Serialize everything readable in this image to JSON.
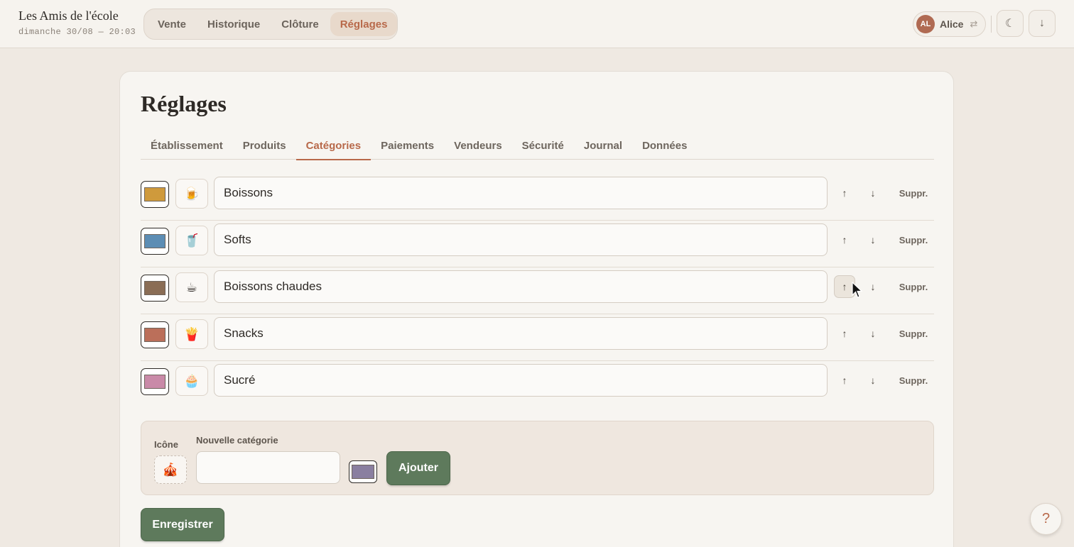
{
  "app": {
    "title": "Les Amis de l'école",
    "datetime": "dimanche 30/08 — 20:03"
  },
  "nav": [
    {
      "label": "Vente",
      "active": false
    },
    {
      "label": "Historique",
      "active": false
    },
    {
      "label": "Clôture",
      "active": false
    },
    {
      "label": "Réglages",
      "active": true
    }
  ],
  "user": {
    "initials": "AL",
    "name": "Alice",
    "switch_icon": "⇄"
  },
  "toolbar": {
    "theme_icon": "☾",
    "download_icon": "↓"
  },
  "page": {
    "title": "Réglages"
  },
  "tabs": [
    {
      "label": "Établissement",
      "active": false
    },
    {
      "label": "Produits",
      "active": false
    },
    {
      "label": "Catégories",
      "active": true
    },
    {
      "label": "Paiements",
      "active": false
    },
    {
      "label": "Vendeurs",
      "active": false
    },
    {
      "label": "Sécurité",
      "active": false
    },
    {
      "label": "Journal",
      "active": false
    },
    {
      "label": "Données",
      "active": false
    }
  ],
  "categories": [
    {
      "name": "Boissons",
      "color": "#cf9a3c",
      "emoji": "🍺"
    },
    {
      "name": "Softs",
      "color": "#5c8db4",
      "emoji": "🥤"
    },
    {
      "name": "Boissons chaudes",
      "color": "#8a6d55",
      "emoji": "☕"
    },
    {
      "name": "Snacks",
      "color": "#bb6f5a",
      "emoji": "🍟"
    },
    {
      "name": "Sucré",
      "color": "#c98aa8",
      "emoji": "🧁"
    }
  ],
  "row_actions": {
    "up_icon": "↑",
    "down_icon": "↓",
    "delete_label": "Suppr."
  },
  "new_category": {
    "icon_label": "Icône",
    "name_label": "Nouvelle catégorie",
    "emoji": "🎪",
    "value": "",
    "color": "#8a7fa0",
    "add_label": "Ajouter"
  },
  "save_label": "Enregistrer",
  "help_icon": "?"
}
